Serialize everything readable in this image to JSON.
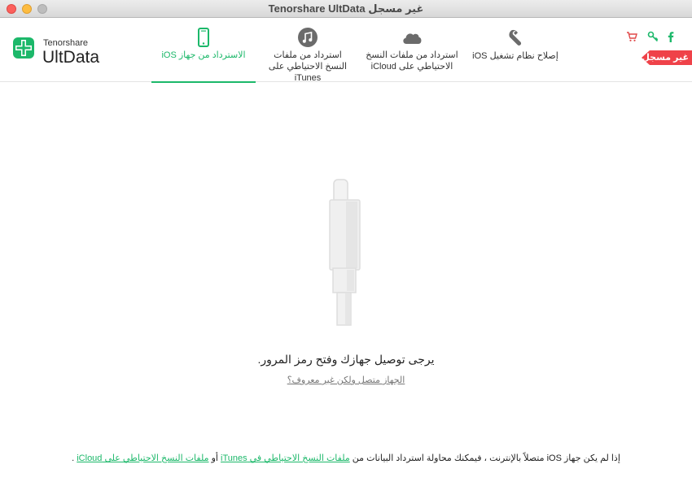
{
  "window": {
    "title": "Tenorshare UltData غير مسجل"
  },
  "brand": {
    "small": "Tenorshare",
    "large": "UltData"
  },
  "tabs": [
    {
      "label": "الاسترداد من جهاز iOS",
      "icon": "phone-icon",
      "active": true
    },
    {
      "label": "استرداد من ملفات النسخ الاحتياطي على iTunes",
      "icon": "music-note-icon",
      "active": false
    },
    {
      "label": "استرداد من ملفات النسخ الاحتياطي على iCloud",
      "icon": "cloud-icon",
      "active": false
    },
    {
      "label": "إصلاح نظام تشغيل iOS",
      "icon": "wrench-icon",
      "active": false
    }
  ],
  "header_icons": [
    "cart-icon",
    "key-icon",
    "facebook-icon"
  ],
  "ribbon": {
    "label": "غير مسجل"
  },
  "main": {
    "prompt": "يرجى توصيل جهازك وفتح رمز المرور.",
    "help_link": "الجهاز متصل ولكن غير معروف؟"
  },
  "footer": {
    "text_start": "إذا لم يكن جهاز iOS متصلاً بالإنترنت ، فيمكنك محاولة استرداد البيانات من ",
    "itunes_link": "ملفات النسخ الاحتياطي في iTunes",
    "text_mid": " أو ",
    "icloud_link": "ملفات النسخ الاحتياطي على iCloud",
    "text_end": " ."
  },
  "colors": {
    "accent": "#1cb86a",
    "ribbon": "#ef4249",
    "icon_gray": "#6b6b6b"
  }
}
